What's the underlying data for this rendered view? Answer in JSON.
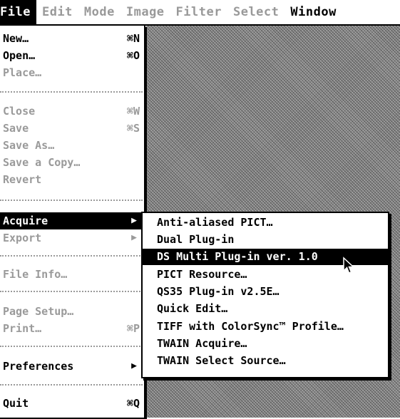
{
  "menubar": {
    "items": [
      {
        "label": "File",
        "state": "active"
      },
      {
        "label": "Edit",
        "state": "disabled"
      },
      {
        "label": "Mode",
        "state": "disabled"
      },
      {
        "label": "Image",
        "state": "disabled"
      },
      {
        "label": "Filter",
        "state": "disabled"
      },
      {
        "label": "Select",
        "state": "disabled"
      },
      {
        "label": "Window",
        "state": "enabled"
      }
    ]
  },
  "file_menu": {
    "items": [
      {
        "label": "New…",
        "shortcut": "⌘N",
        "enabled": true
      },
      {
        "label": "Open…",
        "shortcut": "⌘O",
        "enabled": true
      },
      {
        "label": "Place…",
        "shortcut": "",
        "enabled": false
      },
      {
        "label": "Close",
        "shortcut": "⌘W",
        "enabled": false
      },
      {
        "label": "Save",
        "shortcut": "⌘S",
        "enabled": false
      },
      {
        "label": "Save As…",
        "shortcut": "",
        "enabled": false
      },
      {
        "label": "Save a Copy…",
        "shortcut": "",
        "enabled": false
      },
      {
        "label": "Revert",
        "shortcut": "",
        "enabled": false
      },
      {
        "label": "Acquire",
        "submenu": true,
        "enabled": true,
        "highlighted": true
      },
      {
        "label": "Export",
        "submenu": true,
        "enabled": false
      },
      {
        "label": "File Info…",
        "shortcut": "",
        "enabled": false
      },
      {
        "label": "Page Setup…",
        "shortcut": "",
        "enabled": false
      },
      {
        "label": "Print…",
        "shortcut": "⌘P",
        "enabled": false
      },
      {
        "label": "Preferences",
        "submenu": true,
        "enabled": true
      },
      {
        "label": "Quit",
        "shortcut": "⌘Q",
        "enabled": true
      }
    ]
  },
  "acquire_submenu": {
    "items": [
      {
        "label": "Anti-aliased PICT…",
        "highlighted": false
      },
      {
        "label": "Dual Plug-in",
        "highlighted": false
      },
      {
        "label": "DS Multi Plug-in ver. 1.0",
        "highlighted": true
      },
      {
        "label": "PICT Resource…",
        "highlighted": false
      },
      {
        "label": "QS35 Plug-in v2.5E…",
        "highlighted": false
      },
      {
        "label": "Quick Edit…",
        "highlighted": false
      },
      {
        "label": "TIFF with ColorSync™ Profile…",
        "highlighted": false
      },
      {
        "label": "TWAIN Acquire…",
        "highlighted": false
      },
      {
        "label": "TWAIN Select Source…",
        "highlighted": false
      }
    ]
  },
  "icons": {
    "submenu_arrow": "triangle-right-icon",
    "cursor": "arrow-pointer-icon"
  },
  "colors": {
    "highlight": "#000000",
    "disabled_text": "#9a9a9a",
    "desktop_pattern": "#8a8a8a"
  }
}
